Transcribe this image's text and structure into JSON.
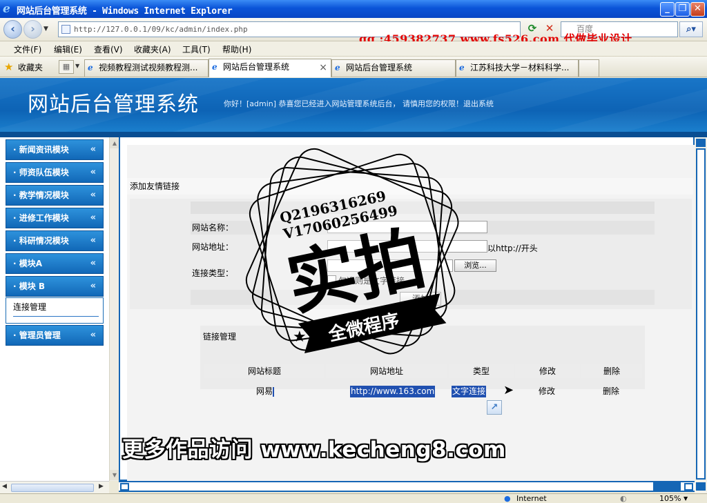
{
  "window": {
    "title": "网站后台管理系统 - Windows Internet Explorer",
    "minimize_glyph": "_",
    "restore_glyph": "❐",
    "close_glyph": "✕"
  },
  "address_bar": {
    "url": "http://127.0.0.1/09/kc/admin/index.php",
    "search_placeholder": "百度"
  },
  "promo_overlay": "qq :459382737 www.fs526.com 代做毕业设计",
  "menu": [
    "文件(F)",
    "编辑(E)",
    "查看(V)",
    "收藏夹(A)",
    "工具(T)",
    "帮助(H)"
  ],
  "favorites_label": "收藏夹",
  "tabs": [
    {
      "label": "视频教程测试视频教程测..."
    },
    {
      "label": "网站后台管理系统"
    },
    {
      "label": "网站后台管理系统"
    },
    {
      "label": "江苏科技大学－材料科学..."
    }
  ],
  "header": {
    "title": "网站后台管理系统",
    "welcome": "你好！[admin] 恭喜您已经进入网站管理系统后台， 请慎用您的权限！退出系统"
  },
  "sidebar": {
    "items": [
      {
        "label": "· 新闻资讯模块"
      },
      {
        "label": "· 师资队伍模块"
      },
      {
        "label": "· 教学情况模块"
      },
      {
        "label": "· 进修工作模块"
      },
      {
        "label": "· 科研情况模块"
      },
      {
        "label": "· 模块A"
      },
      {
        "label": "· 模块 B"
      },
      {
        "label": "· 管理员管理"
      }
    ],
    "chevron": "«",
    "submenu_item": "连接管理"
  },
  "form": {
    "section_title": "添加友情链接",
    "site_name_label": "网站名称：",
    "site_url_label": "网站地址：",
    "url_hint": "以http://开头",
    "link_type_label": "连接类型：",
    "browse_button": "浏览...",
    "text_link_checkbox_label": "勾选则是文字链接",
    "add_button": "添加"
  },
  "links": {
    "section_title": "链接管理",
    "columns": [
      "网站标题",
      "网站地址",
      "类型",
      "修改",
      "删除"
    ],
    "rows": [
      {
        "title": "网易",
        "url": "http://www.163.com",
        "type": "文字连接",
        "edit": "修改",
        "delete": "删除"
      }
    ]
  },
  "watermark": {
    "phone1": "Q2196316269",
    "phone2": "V17060256499",
    "big_text": "实拍",
    "ribbon_text": "全微程序"
  },
  "footer_ad": "更多作品访问 www.kecheng8.com",
  "statusbar": {
    "zone": "Internet",
    "zoom": "105%"
  }
}
